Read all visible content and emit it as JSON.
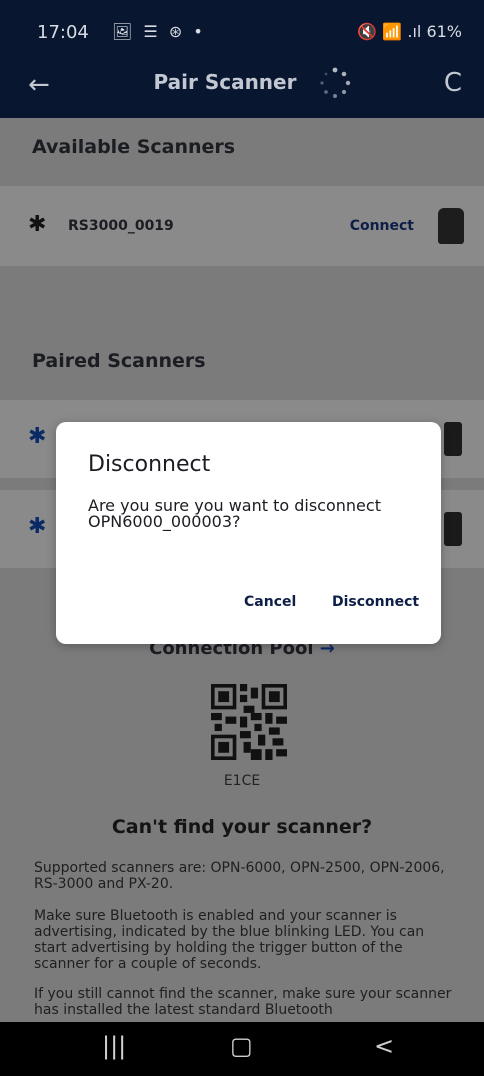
{
  "status_bar": {
    "time": "17:04",
    "left_icons": "🖼 ☰ ⊛ •",
    "right_icons": "🔇 📶 .ıl",
    "battery": "61%"
  },
  "app_bar": {
    "title": "Pair Scanner",
    "back_icon": "←",
    "refresh_icon": "C"
  },
  "available": {
    "heading": "Available Scanners",
    "items": [
      {
        "name": "RS3000_0019",
        "action": "Connect"
      }
    ]
  },
  "paired": {
    "heading": "Paired Scanners"
  },
  "bluetooth_glyph": "✱",
  "connection_pool": {
    "label": "Connection Pool",
    "arrow": "→",
    "qr_label": "E1CE"
  },
  "help": {
    "heading": "Can't find your scanner?",
    "p1": "Supported scanners are: OPN-6000, OPN-2500, OPN-2006, RS-3000 and PX-20.",
    "p2": "Make sure Bluetooth is enabled and your scanner is advertising, indicated by the blue blinking LED. You can start advertising by holding the trigger button of the scanner for a couple of seconds.",
    "p3": "If you still cannot find the scanner, make sure your scanner has installed the latest standard Bluetooth"
  },
  "dialog": {
    "title": "Disconnect",
    "message": "Are you sure you want to disconnect OPN6000_000003?",
    "cancel": "Cancel",
    "confirm": "Disconnect"
  },
  "nav_bar": {
    "recents": "|||",
    "home": "▢",
    "back": "<"
  },
  "colors": {
    "app_bar": "#08162f",
    "link": "#0e1f47",
    "bluetooth": "#0a2a66"
  }
}
